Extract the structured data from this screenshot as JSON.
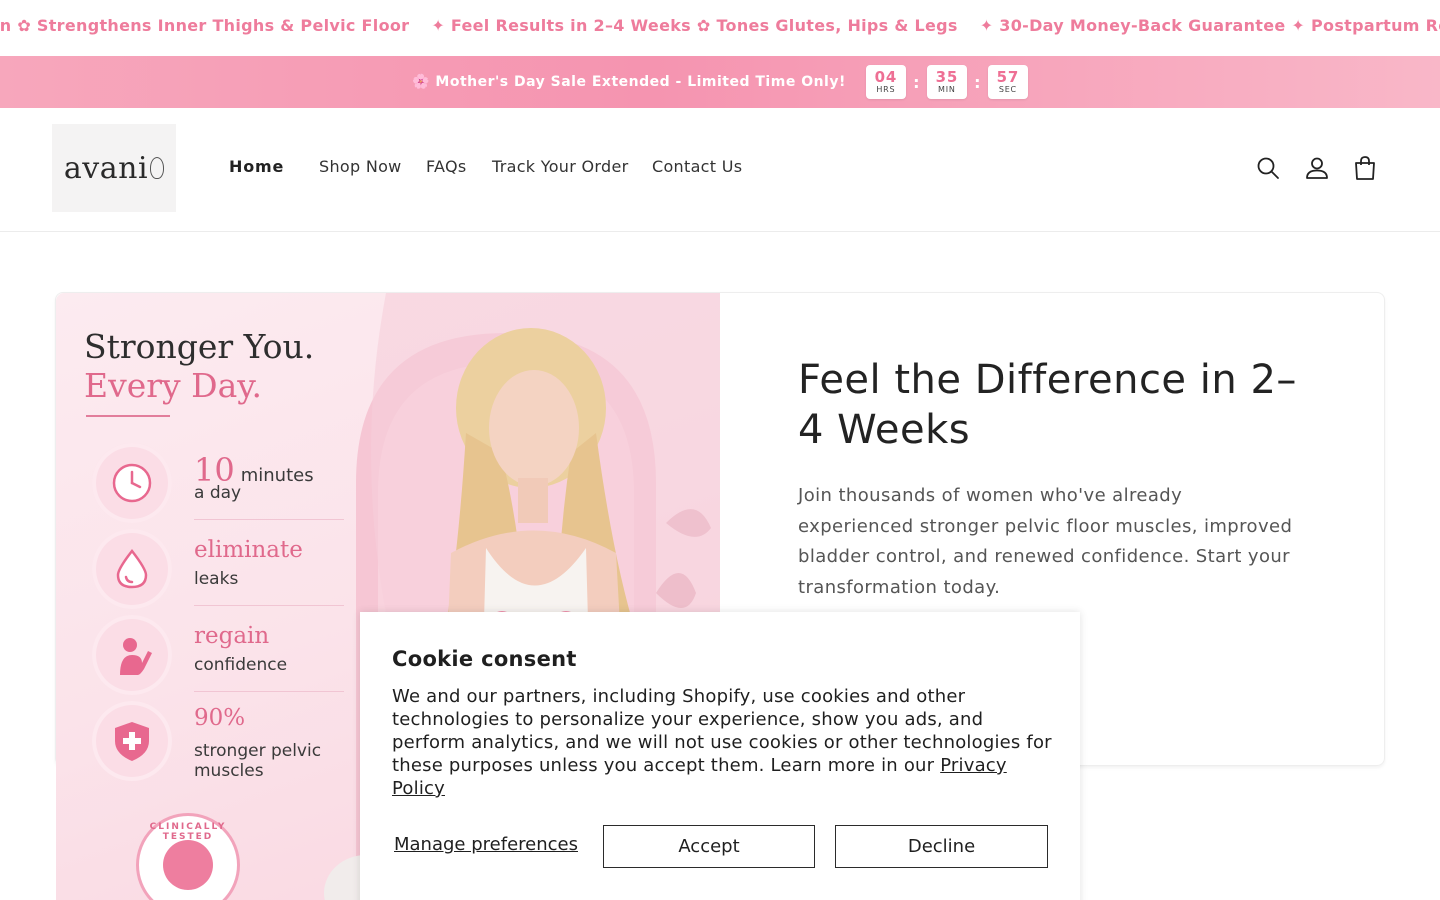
{
  "marquee": {
    "items": [
      "gn ✿ Strengthens Inner Thighs & Pelvic Floor",
      "✦ Feel Results in 2–4 Weeks ✿ Tones Glutes, Hips & Legs",
      "✦ 30-Day Money-Back Guarantee ✦ Postpartum Re"
    ]
  },
  "announcement": {
    "text": "🌸 Mother's Day Sale Extended - Limited Time Only!",
    "countdown": [
      {
        "value": "04",
        "label": "HRS"
      },
      {
        "value": "35",
        "label": "MIN"
      },
      {
        "value": "57",
        "label": "SEC"
      }
    ],
    "separator": ":"
  },
  "header": {
    "logo_text": "avani",
    "nav": [
      "Home",
      "Shop Now",
      "FAQs",
      "Track Your Order",
      "Contact Us"
    ],
    "icons": [
      "search-icon",
      "account-icon",
      "cart-icon"
    ]
  },
  "hero": {
    "image": {
      "headline1": "Stronger You.",
      "headline2": "Every Day.",
      "features": [
        {
          "big": "10",
          "small": "minutes",
          "line2": "a day",
          "icon": "clock-icon"
        },
        {
          "big": "eliminate",
          "small": "",
          "line2": "leaks",
          "icon": "droplet-icon"
        },
        {
          "big": "regain",
          "small": "",
          "line2": "confidence",
          "icon": "woman-flex-icon"
        },
        {
          "big": "90%",
          "small": "",
          "line2": "stronger pelvic muscles",
          "icon": "shield-cross-icon"
        }
      ],
      "badge": "CLINICALLY TESTED"
    },
    "title": "Feel the Difference in 2–4 Weeks",
    "text": "Join thousands of women who've already experienced stronger pelvic floor muscles, improved bladder control, and renewed confidence. Start your transformation today."
  },
  "cookie": {
    "title": "Cookie consent",
    "body": "We and our partners, including Shopify, use cookies and other technologies to personalize your experience, show you ads, and perform analytics, and we will not use cookies or other technologies for these purposes unless you accept them. Learn more in our",
    "link": "Privacy Policy",
    "manage": "Manage preferences",
    "accept": "Accept",
    "decline": "Decline"
  },
  "colors": {
    "accent": "#ee7c9c",
    "banner": "#f594b0"
  }
}
